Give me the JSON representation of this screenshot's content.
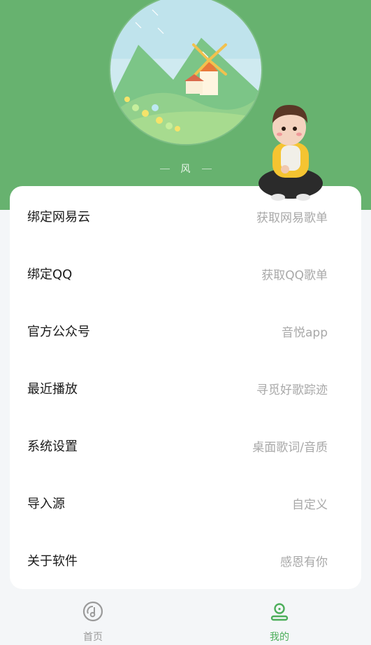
{
  "colors": {
    "header_bg": "#67b26f",
    "accent": "#4cae5a",
    "inactive": "#9a9a9a"
  },
  "profile": {
    "nickname": "风",
    "avatar_icon": "windmill-landscape-avatar",
    "decoration": "cartoon-boy-sitting"
  },
  "menu": [
    {
      "title": "绑定网易云",
      "subtitle": "获取网易歌单"
    },
    {
      "title": "绑定QQ",
      "subtitle": "获取QQ歌单"
    },
    {
      "title": "官方公众号",
      "subtitle": "音悦app"
    },
    {
      "title": "最近播放",
      "subtitle": "寻觅好歌踪迹"
    },
    {
      "title": "系统设置",
      "subtitle": "桌面歌词/音质"
    },
    {
      "title": "导入源",
      "subtitle": "自定义"
    },
    {
      "title": "关于软件",
      "subtitle": "感恩有你"
    }
  ],
  "tabs": [
    {
      "label": "首页",
      "icon": "music-disc-icon",
      "active": false
    },
    {
      "label": "我的",
      "icon": "profile-icon",
      "active": true
    }
  ]
}
